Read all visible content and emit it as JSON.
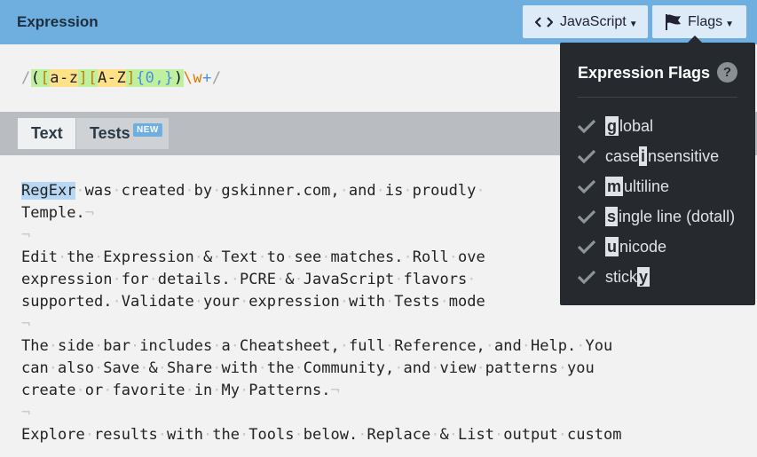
{
  "header": {
    "title": "Expression",
    "js_button_label": "JavaScript",
    "flags_button_label": "Flags"
  },
  "expression": {
    "open_slash": "/",
    "group_open": "(",
    "set1_open": "[",
    "set1_body": "a-z",
    "set1_close": "]",
    "set2_open": "[",
    "set2_body": "A-Z",
    "set2_close": "]",
    "quantifier": "{0,}",
    "group_close": ")",
    "token": "\\w",
    "plus": "+",
    "close_slash": "/"
  },
  "tabs": {
    "text_label": "Text",
    "tests_label": "Tests",
    "new_badge": "NEW"
  },
  "text_lines": [
    [
      "RegExr",
      " was created by gskinner.com, and is proudly "
    ],
    [
      "Temple.",
      ""
    ],
    [
      "",
      ""
    ],
    [
      "Edit the Expression & Text to see matches. Roll ove",
      ""
    ],
    [
      "expression for details. PCRE & JavaScript flavors ",
      ""
    ],
    [
      "supported. Validate your expression with Tests mode",
      ""
    ],
    [
      "",
      ""
    ],
    [
      "The side bar includes a Cheatsheet, full Reference, and Help. You",
      ""
    ],
    [
      "can also Save & Share with the Community, and view patterns you",
      ""
    ],
    [
      "create or favorite in My Patterns.",
      ""
    ],
    [
      "",
      ""
    ],
    [
      "Explore results with the Tools below. Replace & List output custom",
      ""
    ]
  ],
  "flags_panel": {
    "title": "Expression Flags",
    "help_label": "?",
    "flags": [
      {
        "pre": "",
        "key": "g",
        "post": "lobal"
      },
      {
        "pre": "case ",
        "key": "i",
        "post": "nsensitive"
      },
      {
        "pre": "",
        "key": "m",
        "post": "ultiline"
      },
      {
        "pre": "",
        "key": "s",
        "post": "ingle line (dotall)"
      },
      {
        "pre": "",
        "key": "u",
        "post": "nicode"
      },
      {
        "pre": "stick",
        "key": "y",
        "post": ""
      }
    ]
  },
  "colors": {
    "header": "#6fafe0",
    "match": "#b7d7f3",
    "panel": "#262a2e"
  },
  "icons": [
    "code-icon",
    "flag-icon",
    "check-icon",
    "help-icon"
  ]
}
